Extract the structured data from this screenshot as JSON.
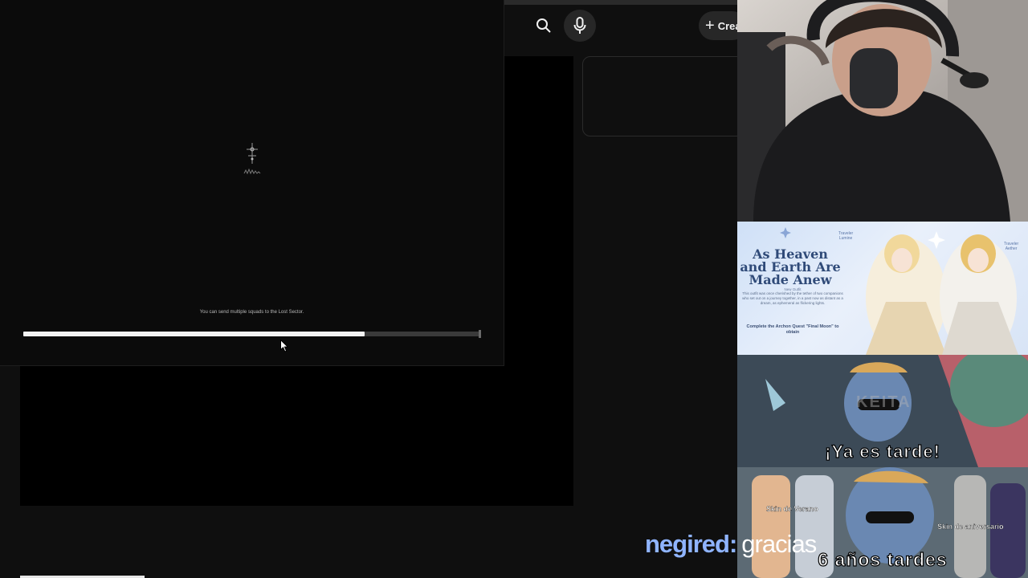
{
  "browser": {
    "create_label": "Crea",
    "create_icon": "plus-icon",
    "search_icon": "search-icon",
    "mic_icon": "microphone-icon"
  },
  "game": {
    "loading_tip": "You can send multiple squads to the Lost Sector.",
    "progress_fraction": 0.745
  },
  "banner": {
    "title": "As Heaven and Earth Are Made Anew",
    "tag_left_name": "Traveler",
    "tag_left_value": "Lumine",
    "tag_right_name": "Traveler",
    "tag_right_value": "Aether",
    "outfit_label": "New Outfit",
    "description": "This outfit was once cherished by the tether of two companions who set out on a journey together, in a past now as distant as a dream, as ephemeral as flickering lights.",
    "quest_text": "Complete the Archon Quest \"Final Moon\" to obtain"
  },
  "meme": {
    "watermark": "KEITA",
    "top_text": "¡Ya es tarde!",
    "label_left": "Skin de Verano",
    "label_right": "Skin de aniversario",
    "bottom_text": "6 años tardes"
  },
  "chat": {
    "username": "negired",
    "separator": ":",
    "message": "gracias"
  },
  "colors": {
    "chat_username": "#8fb4ff",
    "progress_fill": "#f2f2f2",
    "banner_title": "#2f4a78"
  }
}
